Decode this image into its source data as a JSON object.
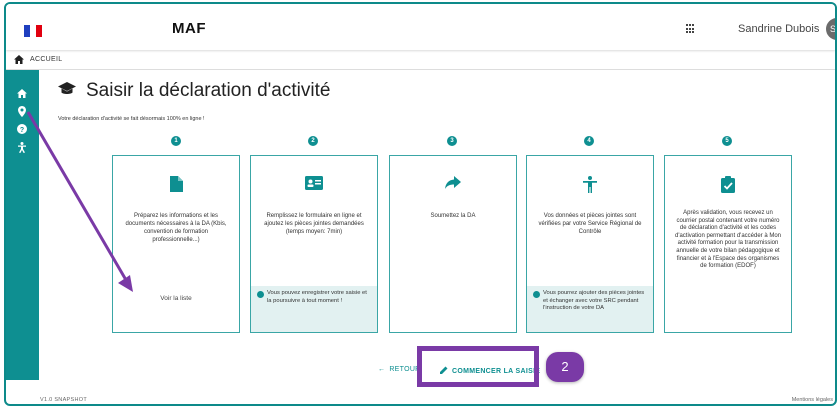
{
  "header": {
    "app_title": "MAF",
    "user_name": "Sandrine Dubois",
    "avatar_initials": "SD"
  },
  "breadcrumb": {
    "label": "ACCUEIL"
  },
  "main": {
    "page_title": "Saisir la déclaration d'activité",
    "intro": "Votre déclaration d'activité se fait désormais 100% en ligne !",
    "steps": [
      {
        "number": "1",
        "icon": "file-icon",
        "text": "Préparez les informations et les documents nécessaires à la DA (Kbis, convention de formation professionnelle...)",
        "link": "Voir la liste"
      },
      {
        "number": "2",
        "icon": "id-card-icon",
        "text": "Remplissez le formulaire en ligne et ajoutez les pièces jointes demandées (temps moyen: 7min)",
        "note": "Vous pouvez enregistrer votre saisie et la poursuivre à tout moment !"
      },
      {
        "number": "3",
        "icon": "share-arrow-icon",
        "text": "Soumettez la DA"
      },
      {
        "number": "4",
        "icon": "person-icon",
        "text": "Vos données et pièces jointes sont vérifiées par votre Service Régional de Contrôle",
        "note": "Vous pourrez ajouter des pièces jointes et échanger avec votre SRC pendant l'instruction de votre DA"
      },
      {
        "number": "5",
        "icon": "clipboard-check-icon",
        "text": "Après validation, vous recevez un courrier postal contenant votre numéro de déclaration d'activité et les codes d'activation permettant d'accéder à Mon activité formation pour la transmission annuelle de votre bilan pédagogique et financier et à l'Espace des organismes de formation (EDOF)"
      }
    ],
    "back_label": "RETOUR",
    "start_label": "COMMENCER LA SAISIE"
  },
  "annotation": {
    "step_badge": "2"
  },
  "footer": {
    "left": "V1.0 SNAPSHOT",
    "right": "Mentions légales"
  },
  "colors": {
    "accent": "#0e8f91",
    "annotation": "#7a3aa6",
    "flag_blue": "#1f3fbf",
    "flag_red": "#e1000f"
  }
}
